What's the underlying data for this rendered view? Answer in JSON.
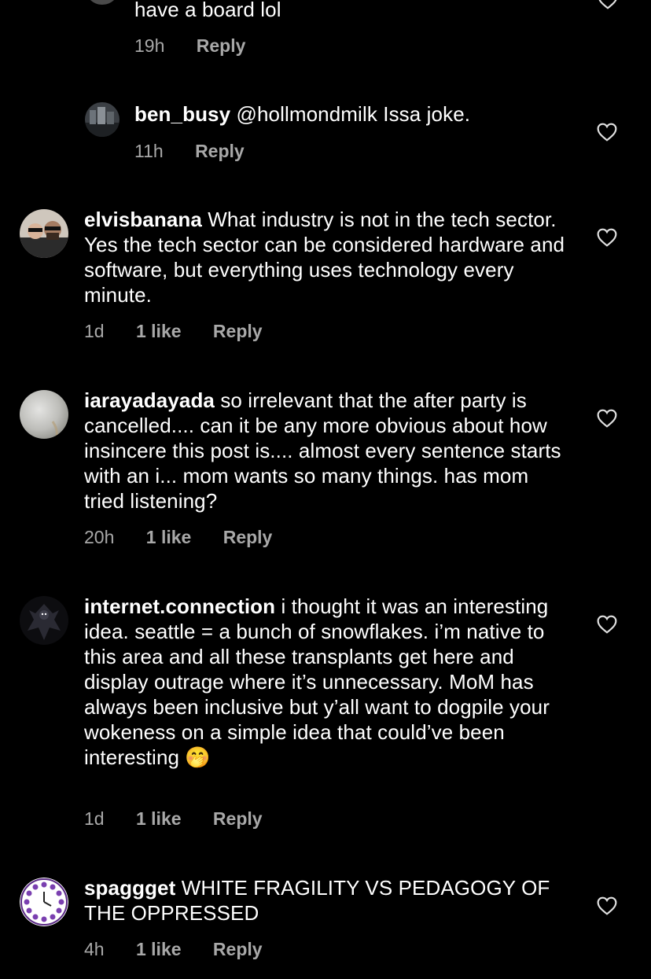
{
  "top_comment_tail": {
    "text": "have a board lol",
    "time": "19h",
    "reply_label": "Reply"
  },
  "comments": [
    {
      "username": "ben_busy",
      "mention": "@hollmondmilk",
      "text": "Issa joke.",
      "time": "11h",
      "likes": "",
      "reply_label": "Reply"
    },
    {
      "username": "elvisbanana",
      "text": "What industry is not in the tech sector. Yes the tech sector can be considered hardware and software, but everything uses technology every minute.",
      "time": "1d",
      "likes": "1 like",
      "reply_label": "Reply"
    },
    {
      "username": "iarayadayada",
      "text": "so irrelevant that the after party is cancelled.... can it be any more obvious about how insincere this post is.... almost every sentence starts with an i... mom wants so many things. has mom tried listening?",
      "time": "20h",
      "likes": "1 like",
      "reply_label": "Reply"
    },
    {
      "username": "internet.connection",
      "text": "i thought it was an interesting idea. seattle = a bunch of snowflakes. i’m native to this area and all these transplants get here and display outrage where it’s unnecessary. MoM has always been inclusive but y’all want to dogpile your wokeness on a simple idea that could’ve been interesting",
      "emoji": "🤭",
      "time": "1d",
      "likes": "1 like",
      "reply_label": "Reply"
    },
    {
      "username": "spaggget",
      "text": "WHITE FRAGILITY VS PEDAGOGY OF THE OPPRESSED",
      "time": "4h",
      "likes": "1 like",
      "reply_label": "Reply"
    }
  ],
  "colors": {
    "background": "#000000",
    "text": "#ffffff",
    "meta": "#a8a8a8"
  },
  "icons": {
    "like": "heart-outline-icon"
  }
}
